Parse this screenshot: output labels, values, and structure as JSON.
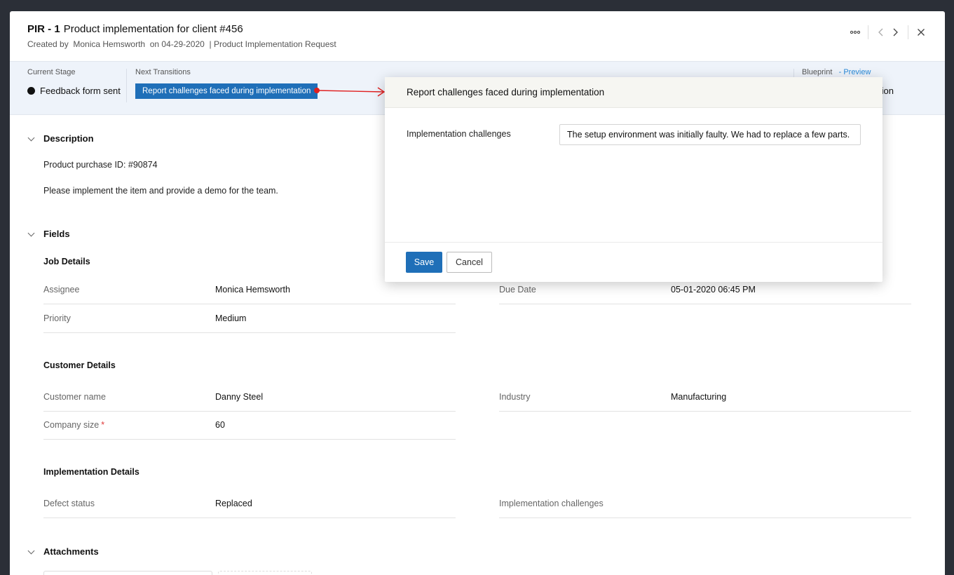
{
  "header": {
    "record_id": "PIR - 1",
    "title": "Product implementation for client #456",
    "created_by_label": "Created by",
    "created_by": "Monica Hemsworth",
    "created_on": "on 04-29-2020",
    "layout": "| Product Implementation Request",
    "icons": [
      "more-icon",
      "chevron-left-icon",
      "chevron-right-icon",
      "close-icon"
    ]
  },
  "stage": {
    "current_label": "Current Stage",
    "current_value": "Feedback form sent",
    "next_label": "Next Transitions",
    "transition_button": "Report challenges faced during implementation",
    "blueprint_label": "Blueprint",
    "preview_link": "- Preview",
    "partial_text": "tion"
  },
  "description": {
    "heading": "Description",
    "line1": "Product purchase ID: #90874",
    "line2": "Please implement the item and provide a demo for the team."
  },
  "fields": {
    "heading": "Fields",
    "job_details": {
      "heading": "Job Details",
      "assignee_label": "Assignee",
      "assignee_value": "Monica Hemsworth",
      "priority_label": "Priority",
      "priority_value": "Medium",
      "due_label": "Due Date",
      "due_value": "05-01-2020 06:45 PM"
    },
    "customer_details": {
      "heading": "Customer Details",
      "name_label": "Customer name",
      "name_value": "Danny Steel",
      "industry_label": "Industry",
      "industry_value": "Manufacturing",
      "size_label": "Company size",
      "size_required": "*",
      "size_value": "60"
    },
    "implementation_details": {
      "heading": "Implementation Details",
      "defect_label": "Defect status",
      "defect_value": "Replaced",
      "challenges_label": "Implementation challenges",
      "challenges_value": ""
    }
  },
  "attachments": {
    "heading": "Attachments"
  },
  "modal": {
    "title": "Report challenges faced during implementation",
    "field_label": "Implementation challenges",
    "field_value": "The setup environment was initially faulty. We had to replace a few parts.",
    "save": "Save",
    "cancel": "Cancel"
  },
  "colors": {
    "primary": "#1f6fb8",
    "link": "#2a8ad8",
    "arrow": "#e02020",
    "required": "#e03a3a",
    "stage_bg": "#eef3fa"
  }
}
